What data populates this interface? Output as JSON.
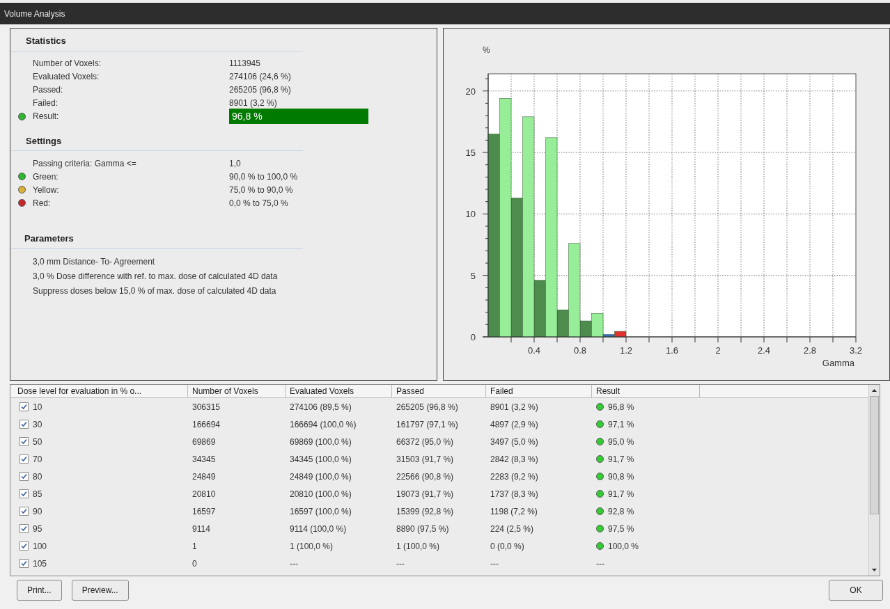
{
  "window": {
    "title": "Volume Analysis"
  },
  "statistics": {
    "heading": "Statistics",
    "rows": [
      {
        "label": "Number of Voxels:",
        "value": "1113945"
      },
      {
        "label": "Evaluated Voxels:",
        "value": "274106 (24,6 %)"
      },
      {
        "label": "Passed:",
        "value": "265205 (96,8 %)"
      },
      {
        "label": "Failed:",
        "value": "8901 (3,2 %)"
      },
      {
        "label": "Result:",
        "value": "96,8 %",
        "kind": "result",
        "color": "#2fb52f"
      }
    ]
  },
  "settings": {
    "heading": "Settings",
    "rows": [
      {
        "label": "Passing criteria: Gamma <=",
        "value": "1,0"
      },
      {
        "label": "Green:",
        "value": "90,0 % to 100,0 %",
        "color": "#2fb52f"
      },
      {
        "label": "Yellow:",
        "value": "75,0 % to 90,0 %",
        "color": "#d9b23a"
      },
      {
        "label": "Red:",
        "value": "0,0 % to 75,0 %",
        "color": "#c62828"
      }
    ]
  },
  "parameters": {
    "heading": "Parameters",
    "lines": [
      "3,0 mm Distance- To- Agreement",
      "3,0 % Dose difference with ref. to max. dose of calculated 4D data",
      "Suppress doses below 15,0 % of max. dose of calculated 4D data"
    ]
  },
  "histogram": {
    "chart_data": {
      "type": "bar",
      "xlabel": "Gamma",
      "ylabel": "%",
      "x": [
        0.05,
        0.15,
        0.25,
        0.35,
        0.45,
        0.55,
        0.65,
        0.75,
        0.85,
        0.95,
        1.05,
        1.15
      ],
      "series": [
        {
          "color": "#4e8c4e",
          "values": [
            16.5,
            null,
            11.3,
            null,
            4.6,
            null,
            2.2,
            null,
            1.3,
            null,
            null,
            null
          ]
        },
        {
          "color": "#98ee98",
          "values": [
            null,
            19.4,
            null,
            17.9,
            null,
            16.2,
            null,
            7.6,
            null,
            1.9,
            null,
            null
          ]
        },
        {
          "color": "#3a6fc4",
          "values": [
            null,
            null,
            null,
            null,
            null,
            null,
            null,
            null,
            null,
            null,
            0.2,
            null
          ]
        },
        {
          "color": "#e03030",
          "values": [
            null,
            null,
            null,
            null,
            null,
            null,
            null,
            null,
            null,
            null,
            null,
            0.45
          ]
        }
      ],
      "xlim": [
        0,
        3.2
      ],
      "ylim": [
        0,
        21.4
      ],
      "xticks": [
        0.4,
        0.8,
        1.2,
        1.6,
        2,
        2.4,
        2.8,
        3.2
      ],
      "yticks": [
        0,
        5,
        10,
        15,
        20
      ],
      "grid": true
    }
  },
  "table": {
    "columns": [
      "Dose level for evaluation in % o...",
      "Number of Voxels",
      "Evaluated Voxels",
      "Passed",
      "Failed",
      "Result"
    ],
    "rows": [
      {
        "checked": true,
        "cells": [
          "10",
          "306315",
          "274106 (89,5 %)",
          "265205 (96,8 %)",
          "8901 (3,2 %)",
          "96,8 %"
        ],
        "color": "#33cc33"
      },
      {
        "checked": true,
        "cells": [
          "30",
          "166694",
          "166694 (100,0 %)",
          "161797 (97,1 %)",
          "4897 (2,9 %)",
          "97,1 %"
        ],
        "color": "#33cc33"
      },
      {
        "checked": true,
        "cells": [
          "50",
          "69869",
          "69869 (100,0 %)",
          "66372 (95,0 %)",
          "3497 (5,0 %)",
          "95,0 %"
        ],
        "color": "#33cc33"
      },
      {
        "checked": true,
        "cells": [
          "70",
          "34345",
          "34345 (100,0 %)",
          "31503 (91,7 %)",
          "2842 (8,3 %)",
          "91,7 %"
        ],
        "color": "#33cc33"
      },
      {
        "checked": true,
        "cells": [
          "80",
          "24849",
          "24849 (100,0 %)",
          "22566 (90,8 %)",
          "2283 (9,2 %)",
          "90,8 %"
        ],
        "color": "#33cc33"
      },
      {
        "checked": true,
        "cells": [
          "85",
          "20810",
          "20810 (100,0 %)",
          "19073 (91,7 %)",
          "1737 (8,3 %)",
          "91,7 %"
        ],
        "color": "#33cc33"
      },
      {
        "checked": true,
        "cells": [
          "90",
          "16597",
          "16597 (100,0 %)",
          "15399 (92,8 %)",
          "1198 (7,2 %)",
          "92,8 %"
        ],
        "color": "#33cc33"
      },
      {
        "checked": true,
        "cells": [
          "95",
          "9114",
          "9114 (100,0 %)",
          "8890 (97,5 %)",
          "224 (2,5 %)",
          "97,5 %"
        ],
        "color": "#33cc33"
      },
      {
        "checked": true,
        "cells": [
          "100",
          "1",
          "1 (100,0 %)",
          "1 (100,0 %)",
          "0 (0,0 %)",
          "100,0 %"
        ],
        "color": "#33cc33"
      },
      {
        "checked": true,
        "cells": [
          "105",
          "0",
          "---",
          "---",
          "---",
          "---"
        ]
      }
    ]
  },
  "buttons": [
    "Print...",
    "Preview...",
    "OK"
  ]
}
